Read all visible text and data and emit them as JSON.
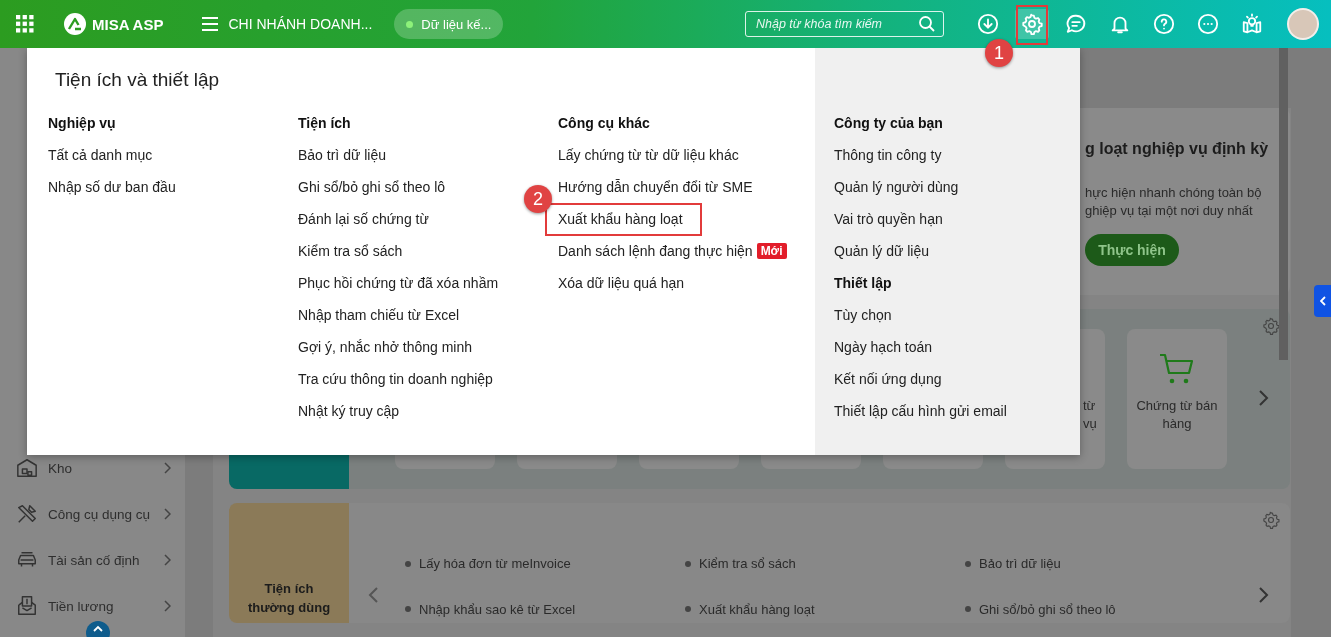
{
  "topbar": {
    "app_name": "MISA ASP",
    "branch": "CHI NHÁNH DOANH...",
    "data_pill": "Dữ liệu kế...",
    "search": {
      "placeholder": "Nhập từ khóa tìm kiếm"
    },
    "actions": [
      {
        "kind": "download",
        "selected": false
      },
      {
        "kind": "settings",
        "selected": true,
        "highlight": "1"
      },
      {
        "kind": "chat",
        "selected": false
      },
      {
        "kind": "bell",
        "selected": false
      },
      {
        "kind": "help",
        "selected": false
      },
      {
        "kind": "more",
        "selected": false
      },
      {
        "kind": "guide",
        "selected": false
      },
      {
        "kind": "avatar",
        "selected": false
      }
    ]
  },
  "sidebar": {
    "items": [
      {
        "kind": "warehouse",
        "label": "Kho"
      },
      {
        "kind": "tools",
        "label": "Công cụ dụng cụ"
      },
      {
        "kind": "car",
        "label": "Tài sản cố định"
      },
      {
        "kind": "payroll",
        "label": "Tiền lương"
      }
    ]
  },
  "periodic_card": {
    "title": "g loạt nghiệp vụ định kỳ",
    "description": [
      "hực hiện nhanh chóng toàn bộ",
      "ghiệp vụ tại một nơi duy nhất"
    ],
    "button": "Thực hiện"
  },
  "shortcuts": {
    "cards": [
      {
        "kind": "empty"
      },
      {
        "kind": "empty"
      },
      {
        "kind": "empty"
      },
      {
        "kind": "empty"
      },
      {
        "kind": "empty"
      },
      {
        "kind": "fragment",
        "lines": [
          "từ",
          "vụ"
        ]
      },
      {
        "kind": "cart",
        "label": "Chứng từ bán hàng"
      }
    ]
  },
  "frequent_utilities": {
    "title": "Tiện ích thường dùng",
    "items": [
      "Lấy hóa đơn từ meInvoice",
      "Kiểm tra sổ sách",
      "Bảo trì dữ liệu",
      "Nhập khẩu sao kê từ Excel",
      "Xuất khẩu hàng loạt",
      "Ghi sổ/bỏ ghi sổ theo lô"
    ]
  },
  "popup": {
    "title": "Tiện ích và thiết lập",
    "columns": [
      {
        "kind": "plain",
        "groups": [
          {
            "heading": "Nghiệp vụ",
            "items": [
              {
                "label": "Tất cả danh mục"
              },
              {
                "label": "Nhập số dư ban đầu"
              }
            ]
          }
        ]
      },
      {
        "kind": "plain",
        "groups": [
          {
            "heading": "Tiện ích",
            "items": [
              {
                "label": "Bảo trì dữ liệu"
              },
              {
                "label": "Ghi sổ/bỏ ghi sổ theo lô"
              },
              {
                "label": "Đánh lại số chứng từ"
              },
              {
                "label": "Kiểm tra sổ sách"
              },
              {
                "label": "Phục hồi chứng từ đã xóa nhầm"
              },
              {
                "label": "Nhập tham chiếu từ Excel"
              },
              {
                "label": "Gợi ý, nhắc nhở thông minh"
              },
              {
                "label": "Tra cứu thông tin doanh nghiệp"
              },
              {
                "label": "Nhật ký truy cập"
              }
            ]
          }
        ]
      },
      {
        "kind": "plain",
        "groups": [
          {
            "heading": "Công cụ khác",
            "items": [
              {
                "label": "Lấy chứng từ từ dữ liệu khác"
              },
              {
                "label": "Hướng dẫn chuyển đổi từ SME"
              },
              {
                "label": "Xuất khẩu hàng loạt",
                "highlight": "2"
              },
              {
                "label": "Danh sách lệnh đang thực hiện",
                "badge": "Mới"
              },
              {
                "label": "Xóa dữ liệu quá hạn"
              }
            ]
          }
        ]
      },
      {
        "kind": "panel",
        "groups": [
          {
            "heading": "Công ty của bạn",
            "items": [
              {
                "label": "Thông tin công ty"
              },
              {
                "label": "Quản lý người dùng"
              },
              {
                "label": "Vai trò quyền hạn"
              },
              {
                "label": "Quản lý dữ liệu"
              }
            ]
          },
          {
            "heading": "Thiết lập",
            "items": [
              {
                "label": "Tùy chọn"
              },
              {
                "label": "Ngày hạch toán"
              },
              {
                "label": "Kết nối ứng dụng"
              },
              {
                "label": "Thiết lập cấu hình gửi email"
              }
            ]
          }
        ]
      }
    ]
  }
}
